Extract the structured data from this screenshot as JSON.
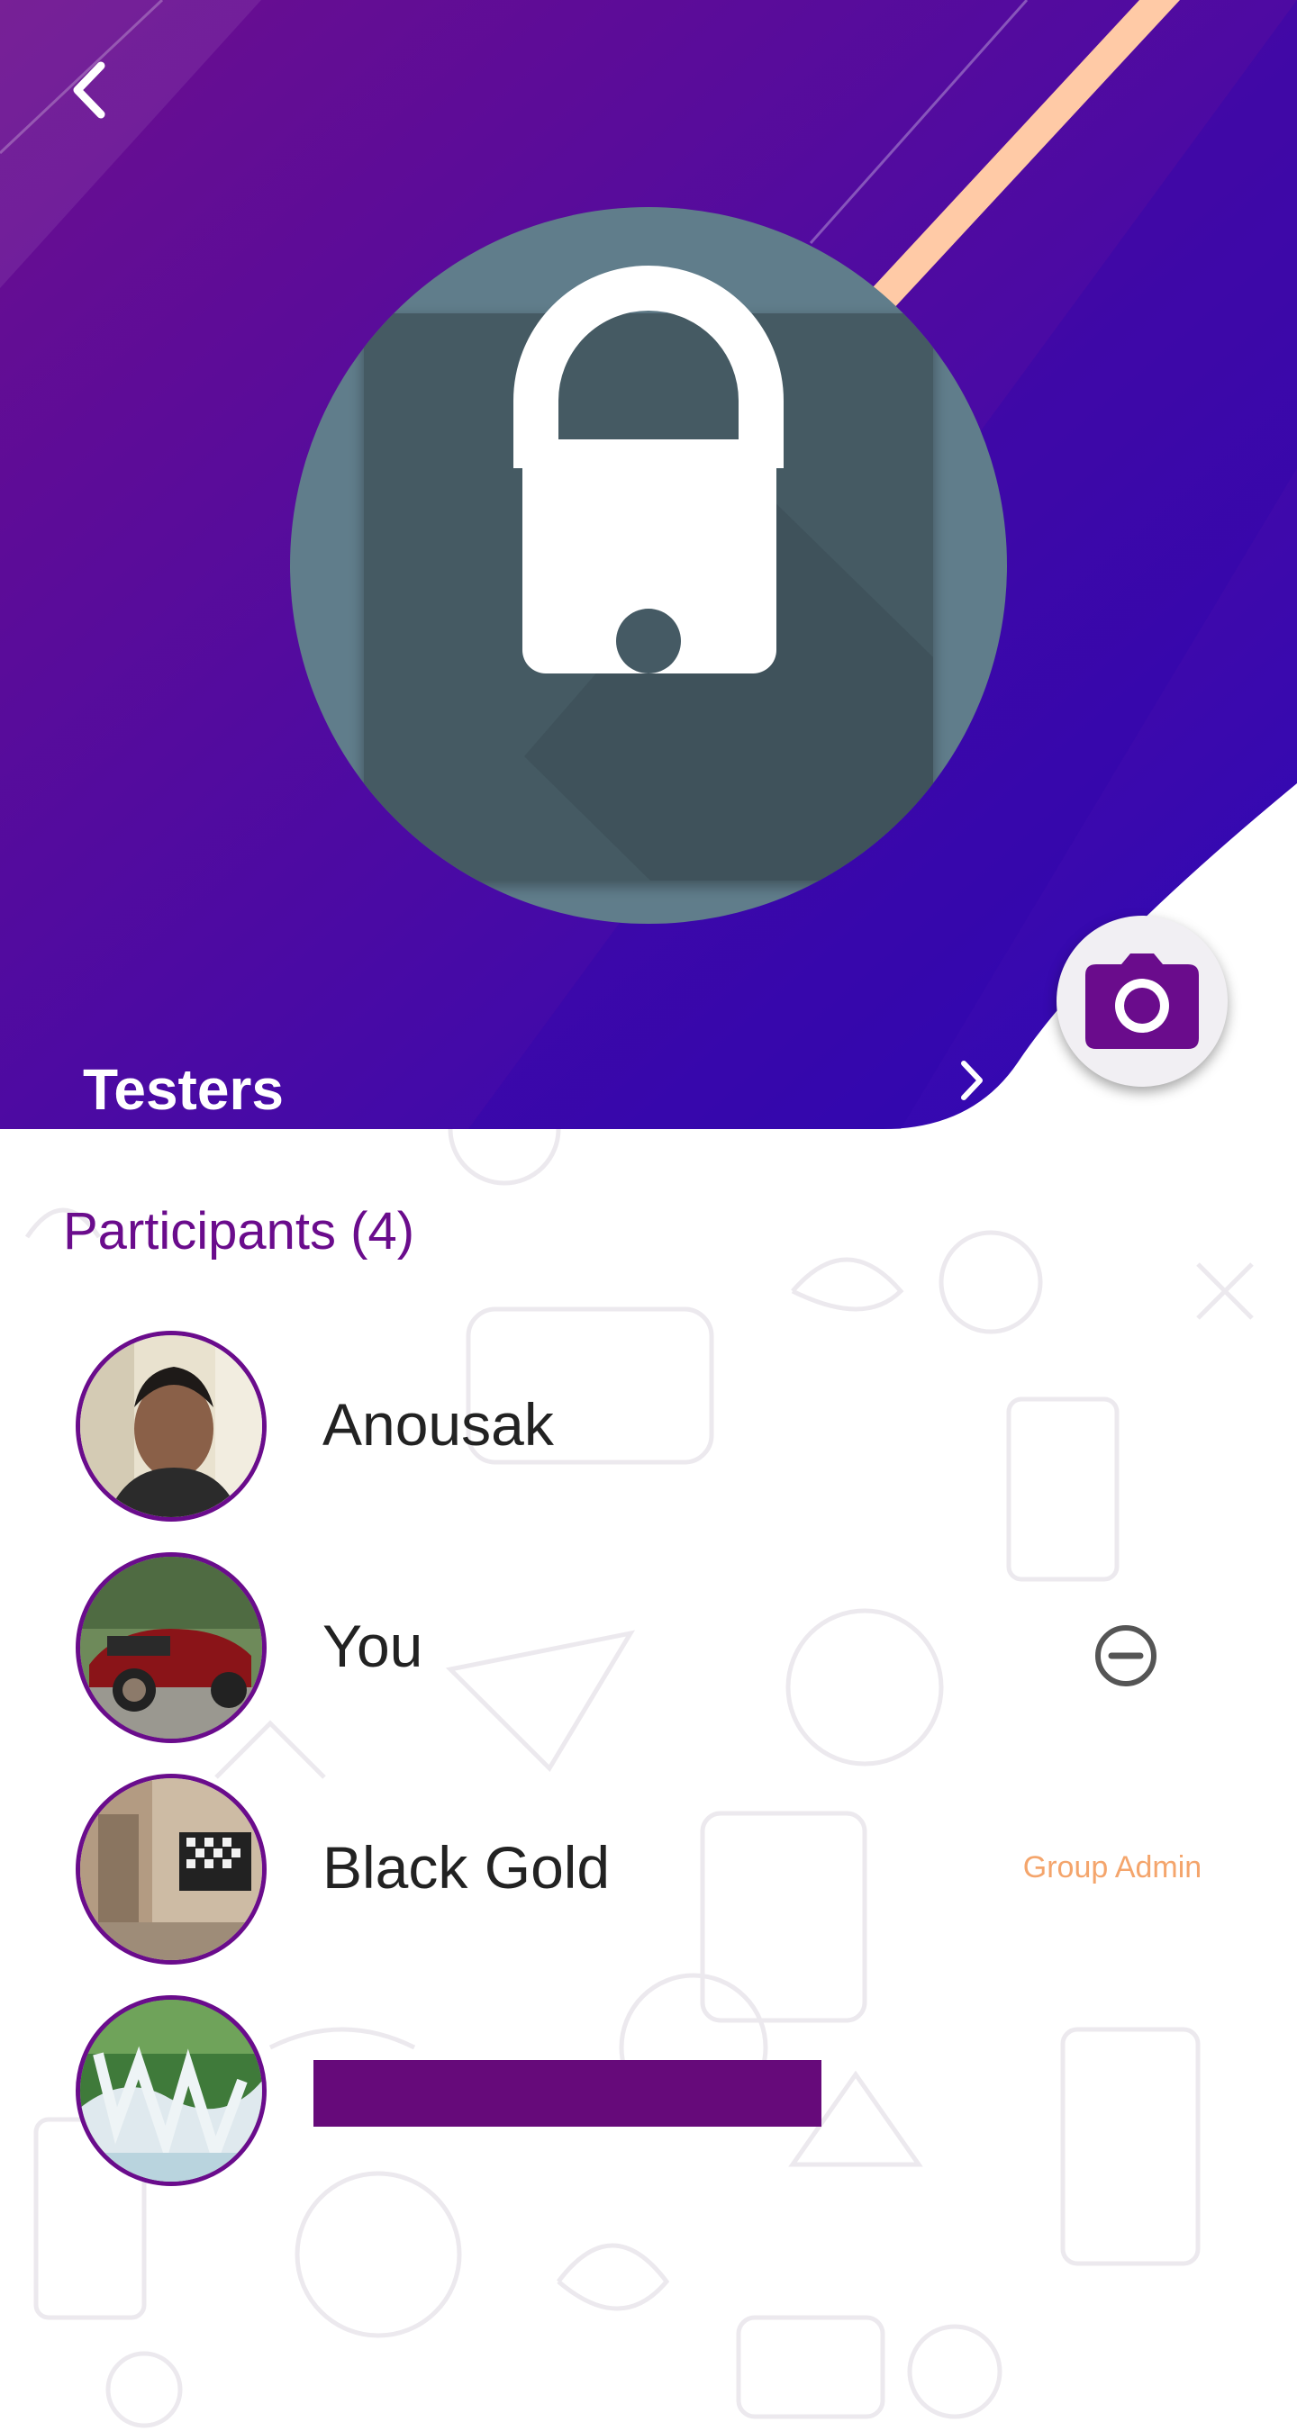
{
  "header": {
    "group_name": "Testers",
    "back_icon": "chevron-left-icon",
    "group_avatar_icon": "lock-icon",
    "open_icon": "chevron-right-icon",
    "camera_icon": "camera-icon"
  },
  "participants": {
    "title": "Participants (4)",
    "items": [
      {
        "name": "Anousak",
        "avatar": "photo-man"
      },
      {
        "name": "You",
        "avatar": "photo-red-car",
        "action_icon": "minus-circle-icon"
      },
      {
        "name": "Black Gold",
        "avatar": "photo-room",
        "badge": "Group Admin"
      },
      {
        "name": "",
        "avatar": "photo-waterfall",
        "redacted": true
      }
    ]
  },
  "colors": {
    "header_gradient_start": "#6a0e94",
    "header_gradient_end": "#3308b0",
    "accent_stripe": "#ffcaa6",
    "avatar_bg": "#607d8b",
    "primary": "#6a0c8c",
    "admin_badge": "#f4a56c"
  }
}
